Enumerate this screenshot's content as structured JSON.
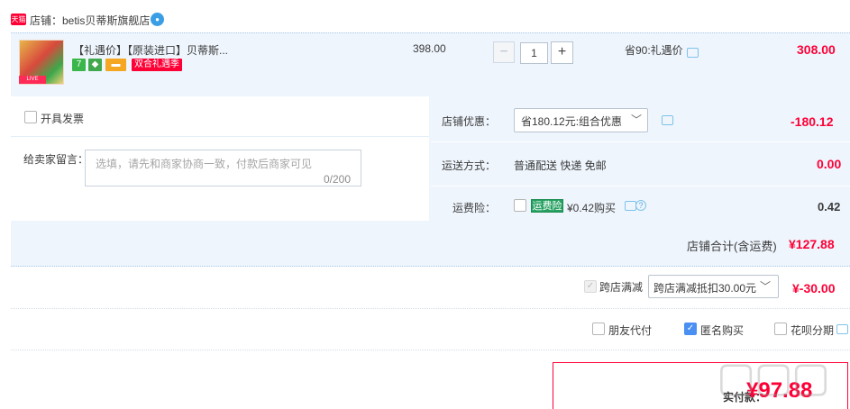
{
  "shop": {
    "badge": "天猫",
    "name": "店铺：betis贝蒂斯旗舰店"
  },
  "item": {
    "thumb_tag": "LIVE",
    "title": "【礼遇价】【原装进口】贝蒂斯...",
    "service_icons": [
      "7",
      "◆",
      "▬"
    ],
    "promo_badge": "双合礼遇季",
    "unit_price": "398.00",
    "quantity": "1",
    "qty_minus": "−",
    "qty_plus": "+",
    "discount_note": "省90:礼遇价",
    "subtotal": "308.00"
  },
  "invoice": {
    "label": "开具发票"
  },
  "message": {
    "label": "给卖家留言：",
    "placeholder": "选填，请先和商家协商一致，付款后商家可见",
    "counter": "0/200"
  },
  "coupon": {
    "label": "店铺优惠：",
    "selected": "省180.12元:组合优惠",
    "amount": "-180.12"
  },
  "shipping": {
    "label": "运送方式：",
    "method": "普通配送 快递 免邮",
    "amount": "0.00"
  },
  "insurance": {
    "label": "运费险：",
    "badge": "运费险",
    "text": "¥0.42购买",
    "help": "?",
    "amount": "0.42"
  },
  "shop_total": {
    "label": "店铺合计(含运费)",
    "amount": "¥127.88"
  },
  "cross_store": {
    "label": "跨店满减",
    "selected": "跨店满减抵扣30.00元",
    "amount": "¥-30.00"
  },
  "options": {
    "friend_pay": "朋友代付",
    "anonymous": "匿名购买",
    "huabei": "花呗分期"
  },
  "payment": {
    "label": "实付款：",
    "amount": "¥97.88"
  },
  "colors": {
    "accent": "#ff0036",
    "panel": "#eef5fd",
    "checkbox_checked": "#4a8ff2",
    "insurance_green": "#27a162"
  },
  "icons": {
    "shop_chat": "chat-bubble-icon",
    "discount_msg": "message-icon",
    "chevron": "chevron-down-icon"
  }
}
